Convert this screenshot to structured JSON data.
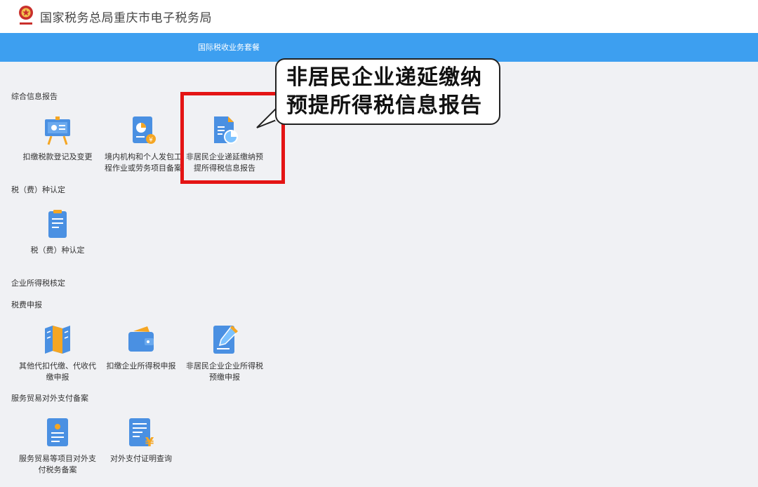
{
  "header": {
    "site_title": "国家税务总局重庆市电子税务局",
    "emblem": "tax-emblem-icon"
  },
  "nav": {
    "items": [
      {
        "label": "国际税收业务套餐"
      }
    ]
  },
  "sections": [
    {
      "title": "综合信息报告",
      "tiles": [
        {
          "label": "扣缴税款登记及变更",
          "icon": "presentation-board-icon"
        },
        {
          "label": "境内机构和个人发包工程作业或劳务项目备案",
          "icon": "document-pie-chart-icon"
        },
        {
          "label": "非居民企业递延缴纳预提所得税信息报告",
          "icon": "document-chart-icon"
        }
      ]
    },
    {
      "title": "税（费）种认定",
      "tiles": [
        {
          "label": "税（费）种认定",
          "icon": "clipboard-icon"
        }
      ]
    },
    {
      "title": "企业所得税核定",
      "tiles": []
    },
    {
      "title": "税费申报",
      "tiles": [
        {
          "label": "其他代扣代缴、代收代缴申报",
          "icon": "folded-map-icon"
        },
        {
          "label": "扣缴企业所得税申报",
          "icon": "wallet-icon"
        },
        {
          "label": "非居民企业企业所得税预缴申报",
          "icon": "edit-document-icon"
        }
      ]
    },
    {
      "title": "服务贸易对外支付备案",
      "tiles": [
        {
          "label": "服务贸易等项目对外支付税务备案",
          "icon": "id-document-icon"
        },
        {
          "label": "对外支付证明查询",
          "icon": "yuan-document-icon"
        }
      ]
    }
  ],
  "callout": {
    "line1": "非居民企业递延缴纳",
    "line2": "预提所得税信息报告"
  },
  "colors": {
    "nav_blue": "#3d9ff0",
    "icon_blue": "#4a90e2",
    "icon_orange": "#f5a623",
    "highlight_red": "#e41414",
    "background": "#f0f1f4"
  }
}
